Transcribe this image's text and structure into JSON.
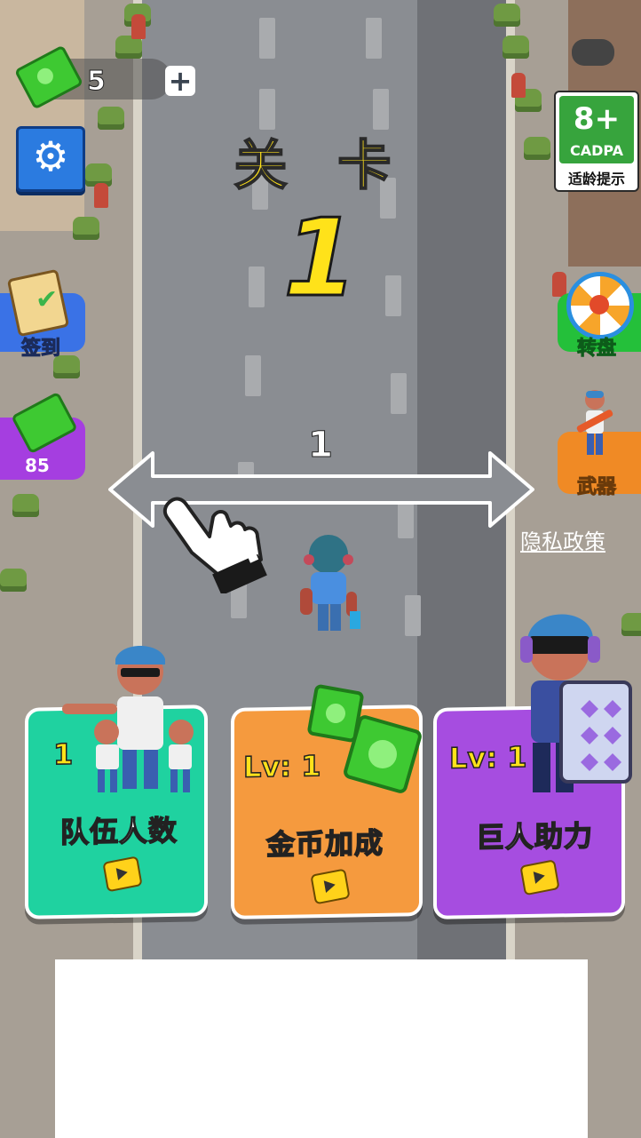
{
  "hud": {
    "money_count": "5",
    "plus_label": "+",
    "settings_icon": "gear-icon"
  },
  "level": {
    "title": "关 卡",
    "number": "1"
  },
  "swipe": {
    "count": "1"
  },
  "left_buttons": {
    "signin_label": "签到",
    "cash_count": "85"
  },
  "right_buttons": {
    "wheel_label": "转盘",
    "weapon_label": "武器"
  },
  "age_rating": {
    "age": "8+",
    "org": "CADPA",
    "note": "适龄提示"
  },
  "privacy_link": "隐私政策",
  "cards": [
    {
      "level": "1",
      "label": "队伍人数",
      "color": "#1fd2a0"
    },
    {
      "level": "Lv: 1",
      "label": "金币加成",
      "color": "#f59a3e"
    },
    {
      "level": "Lv: 1",
      "label": "巨人助力",
      "color": "#a64de0"
    }
  ],
  "colors": {
    "level_text": "#ffe21a",
    "road": "#8a8d92"
  }
}
